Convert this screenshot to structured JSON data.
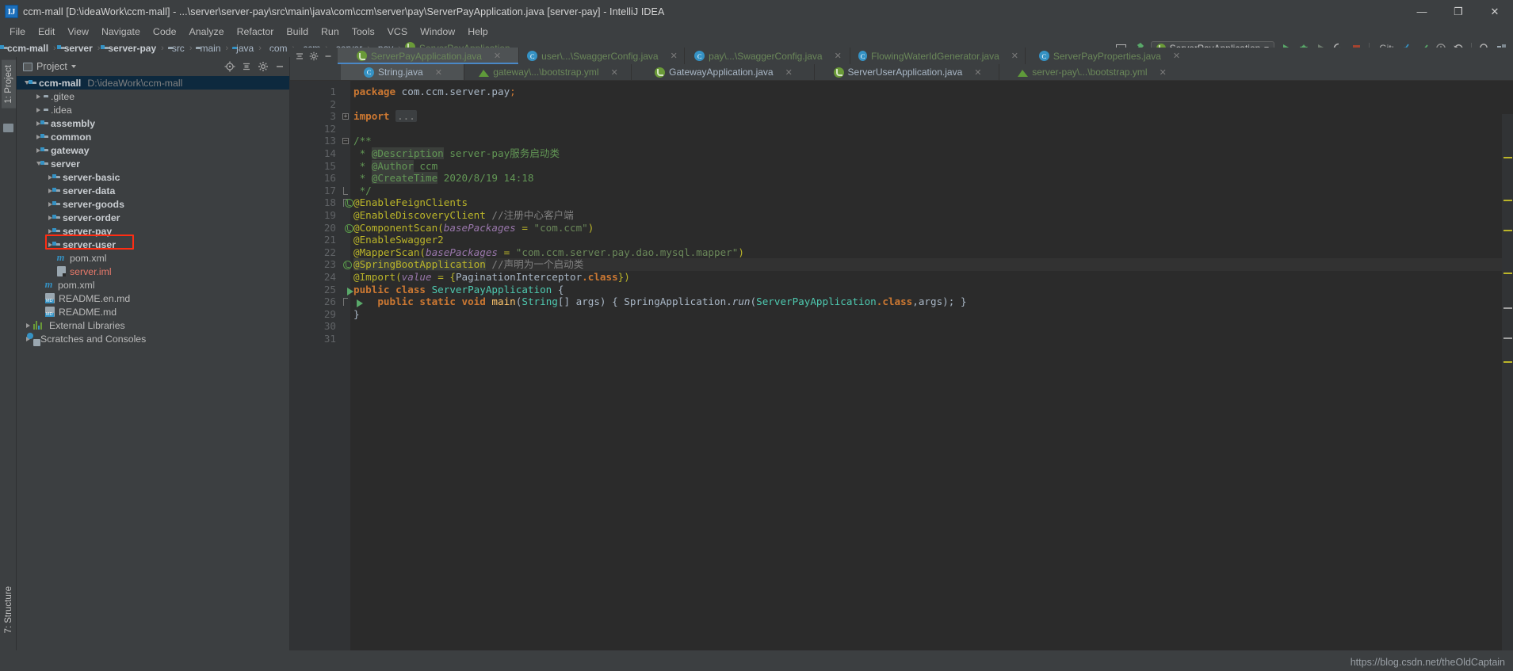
{
  "window": {
    "title": "ccm-mall [D:\\ideaWork\\ccm-mall] - ...\\server\\server-pay\\src\\main\\java\\com\\ccm\\server\\pay\\ServerPayApplication.java [server-pay] - IntelliJ IDEA",
    "logo": "intellij-idea-logo",
    "minimize": "—",
    "maximize": "❐",
    "close": "✕"
  },
  "menubar": {
    "items": [
      "File",
      "Edit",
      "View",
      "Navigate",
      "Code",
      "Analyze",
      "Refactor",
      "Build",
      "Run",
      "Tools",
      "VCS",
      "Window",
      "Help"
    ]
  },
  "breadcrumb": {
    "items": [
      {
        "label": "ccm-mall",
        "icon": "module-folder-icon",
        "style": "bold"
      },
      {
        "label": "server",
        "icon": "module-folder-icon",
        "style": "bold"
      },
      {
        "label": "server-pay",
        "icon": "module-folder-icon",
        "style": "bold"
      },
      {
        "label": "src",
        "icon": "folder-icon",
        "style": "normal"
      },
      {
        "label": "main",
        "icon": "folder-icon",
        "style": "normal"
      },
      {
        "label": "java",
        "icon": "source-root-icon",
        "style": "normal"
      },
      {
        "label": "com",
        "icon": "package-icon",
        "style": "normal"
      },
      {
        "label": "ccm",
        "icon": "package-icon",
        "style": "normal"
      },
      {
        "label": "server",
        "icon": "package-icon",
        "style": "normal"
      },
      {
        "label": "pay",
        "icon": "package-icon",
        "style": "normal"
      },
      {
        "label": "ServerPayApplication",
        "icon": "spring-boot-icon",
        "style": "green"
      }
    ],
    "separator": "›"
  },
  "toolbar": {
    "run_config": "ServerPayApplication",
    "git_label": "Git:",
    "icons": [
      "toggle-tool-window-icon",
      "build-hammer-icon",
      "run-icon",
      "debug-icon",
      "run-with-coverage-icon",
      "profile-icon",
      "stop-icon",
      "update-project-icon",
      "commit-icon",
      "rollback-icon",
      "history-icon",
      "search-everywhere-icon",
      "project-structure-icon"
    ]
  },
  "left_strip": {
    "project_tab": "1: Project",
    "structure_tab": "7: Structure",
    "favorites_icon": "favorites-icon"
  },
  "project_panel": {
    "title": "Project",
    "header_icons": [
      "locate-icon",
      "collapse-all-icon",
      "settings-gear-icon",
      "hide-icon"
    ],
    "tree": [
      {
        "label": "ccm-mall",
        "path": "D:\\ideaWork\\ccm-mall",
        "indent": 0,
        "arrow": "open",
        "icon": "module-folder-icon",
        "bold": true,
        "selected": true
      },
      {
        "label": ".gitee",
        "indent": 1,
        "arrow": "closed",
        "icon": "folder-icon",
        "bold": false
      },
      {
        "label": ".idea",
        "indent": 1,
        "arrow": "closed",
        "icon": "folder-icon",
        "bold": false
      },
      {
        "label": "assembly",
        "indent": 1,
        "arrow": "closed",
        "icon": "module-folder-icon",
        "bold": true
      },
      {
        "label": "common",
        "indent": 1,
        "arrow": "closed",
        "icon": "module-folder-icon",
        "bold": true
      },
      {
        "label": "gateway",
        "indent": 1,
        "arrow": "closed",
        "icon": "module-folder-icon",
        "bold": true
      },
      {
        "label": "server",
        "indent": 1,
        "arrow": "open",
        "icon": "module-folder-icon",
        "bold": true
      },
      {
        "label": "server-basic",
        "indent": 2,
        "arrow": "closed",
        "icon": "module-folder-icon",
        "bold": true
      },
      {
        "label": "server-data",
        "indent": 2,
        "arrow": "closed",
        "icon": "module-folder-icon",
        "bold": true
      },
      {
        "label": "server-goods",
        "indent": 2,
        "arrow": "closed",
        "icon": "module-folder-icon",
        "bold": true
      },
      {
        "label": "server-order",
        "indent": 2,
        "arrow": "closed",
        "icon": "module-folder-icon",
        "bold": true
      },
      {
        "label": "server-pay",
        "indent": 2,
        "arrow": "closed",
        "icon": "module-folder-icon",
        "bold": true,
        "highlight": true
      },
      {
        "label": "server-user",
        "indent": 2,
        "arrow": "closed",
        "icon": "module-folder-icon",
        "bold": true
      },
      {
        "label": "pom.xml",
        "indent": 2,
        "arrow": "none",
        "icon": "maven-icon",
        "bold": false
      },
      {
        "label": "server.iml",
        "indent": 2,
        "arrow": "none",
        "icon": "iml-icon",
        "bold": false,
        "color": "red"
      },
      {
        "label": "pom.xml",
        "indent": 1,
        "arrow": "none",
        "icon": "maven-icon",
        "bold": false
      },
      {
        "label": "README.en.md",
        "indent": 1,
        "arrow": "none",
        "icon": "markdown-icon",
        "bold": false
      },
      {
        "label": "README.md",
        "indent": 1,
        "arrow": "none",
        "icon": "markdown-icon",
        "bold": false
      },
      {
        "label": "External Libraries",
        "indent": 0,
        "arrow": "closed",
        "icon": "libraries-icon",
        "bold": false
      },
      {
        "label": "Scratches and Consoles",
        "indent": 0,
        "arrow": "closed",
        "icon": "scratches-icon",
        "bold": false
      }
    ]
  },
  "editor_tabs": {
    "row1": [
      {
        "label": "ServerPayApplication.java",
        "icon": "spring-boot-icon",
        "active": true,
        "color": "green",
        "close": "✕"
      },
      {
        "label": "user\\...\\SwaggerConfig.java",
        "icon": "java-class-icon",
        "active": false,
        "color": "green",
        "close": "✕"
      },
      {
        "label": "pay\\...\\SwaggerConfig.java",
        "icon": "java-class-icon",
        "active": false,
        "color": "green",
        "close": "✕"
      },
      {
        "label": "FlowingWaterIdGenerator.java",
        "icon": "java-class-icon",
        "active": false,
        "color": "green",
        "close": "✕"
      },
      {
        "label": "ServerPayProperties.java",
        "icon": "java-class-icon",
        "active": false,
        "color": "green",
        "close": "✕"
      }
    ],
    "row2": [
      {
        "label": "String.java",
        "icon": "java-class-icon",
        "active": false,
        "color": "grey",
        "close": "✕"
      },
      {
        "label": "gateway\\...\\bootstrap.yml",
        "icon": "yaml-icon",
        "active": false,
        "color": "green",
        "close": "✕"
      },
      {
        "label": "GatewayApplication.java",
        "icon": "spring-boot-icon",
        "active": false,
        "color": "grey",
        "close": "✕"
      },
      {
        "label": "ServerUserApplication.java",
        "icon": "spring-boot-icon",
        "active": false,
        "color": "grey",
        "close": "✕"
      },
      {
        "label": "server-pay\\...\\bootstrap.yml",
        "icon": "yaml-icon",
        "active": false,
        "color": "green",
        "close": "✕"
      }
    ]
  },
  "code": {
    "line_numbers": [
      "1",
      "2",
      "3",
      "12",
      "13",
      "14",
      "15",
      "16",
      "17",
      "18",
      "19",
      "20",
      "21",
      "22",
      "23",
      "24",
      "25",
      "26",
      "29",
      "30",
      "31"
    ],
    "lines": [
      {
        "n": "1",
        "text": "package com.ccm.server.pay;"
      },
      {
        "n": "2",
        "text": ""
      },
      {
        "n": "3",
        "text": "import ..."
      },
      {
        "n": "12",
        "text": ""
      },
      {
        "n": "13",
        "text": "/**"
      },
      {
        "n": "14",
        "text": " * @Description server-pay服务启动类"
      },
      {
        "n": "15",
        "text": " * @Author ccm"
      },
      {
        "n": "16",
        "text": " * @CreateTime 2020/8/19 14:18"
      },
      {
        "n": "17",
        "text": " */"
      },
      {
        "n": "18",
        "text": "@EnableFeignClients"
      },
      {
        "n": "19",
        "text": "@EnableDiscoveryClient //注册中心客户端"
      },
      {
        "n": "20",
        "text": "@ComponentScan(basePackages = \"com.ccm\")"
      },
      {
        "n": "21",
        "text": "@EnableSwagger2"
      },
      {
        "n": "22",
        "text": "@MapperScan(basePackages = \"com.ccm.server.pay.dao.mysql.mapper\")"
      },
      {
        "n": "23",
        "text": "@SpringBootApplication //声明为一个启动类"
      },
      {
        "n": "24",
        "text": "@Import(value = {PaginationInterceptor.class})"
      },
      {
        "n": "25",
        "text": "public class ServerPayApplication {"
      },
      {
        "n": "26",
        "text": "    public static void main(String[] args) { SpringApplication.run(ServerPayApplication.class,args); }"
      },
      {
        "n": "29",
        "text": "}"
      },
      {
        "n": "30",
        "text": ""
      },
      {
        "n": "31",
        "text": ""
      }
    ]
  },
  "status": {
    "watermark": "https://blog.csdn.net/theOldCaptain"
  },
  "colors": {
    "editor_bg": "#2b2b2b",
    "panel_bg": "#3c3f41",
    "gutter_bg": "#313335",
    "selection_blue": "#0d293e",
    "tab_active": "#4e5254",
    "tab_underline": "#4a88c7",
    "highlight_red": "#ff2d13",
    "string_green": "#6a8759",
    "annotation_yellow": "#bbb529",
    "keyword_orange": "#cc7832",
    "javadoc_green": "#629755",
    "comment_grey": "#808080",
    "text_default": "#a9b7c6"
  }
}
